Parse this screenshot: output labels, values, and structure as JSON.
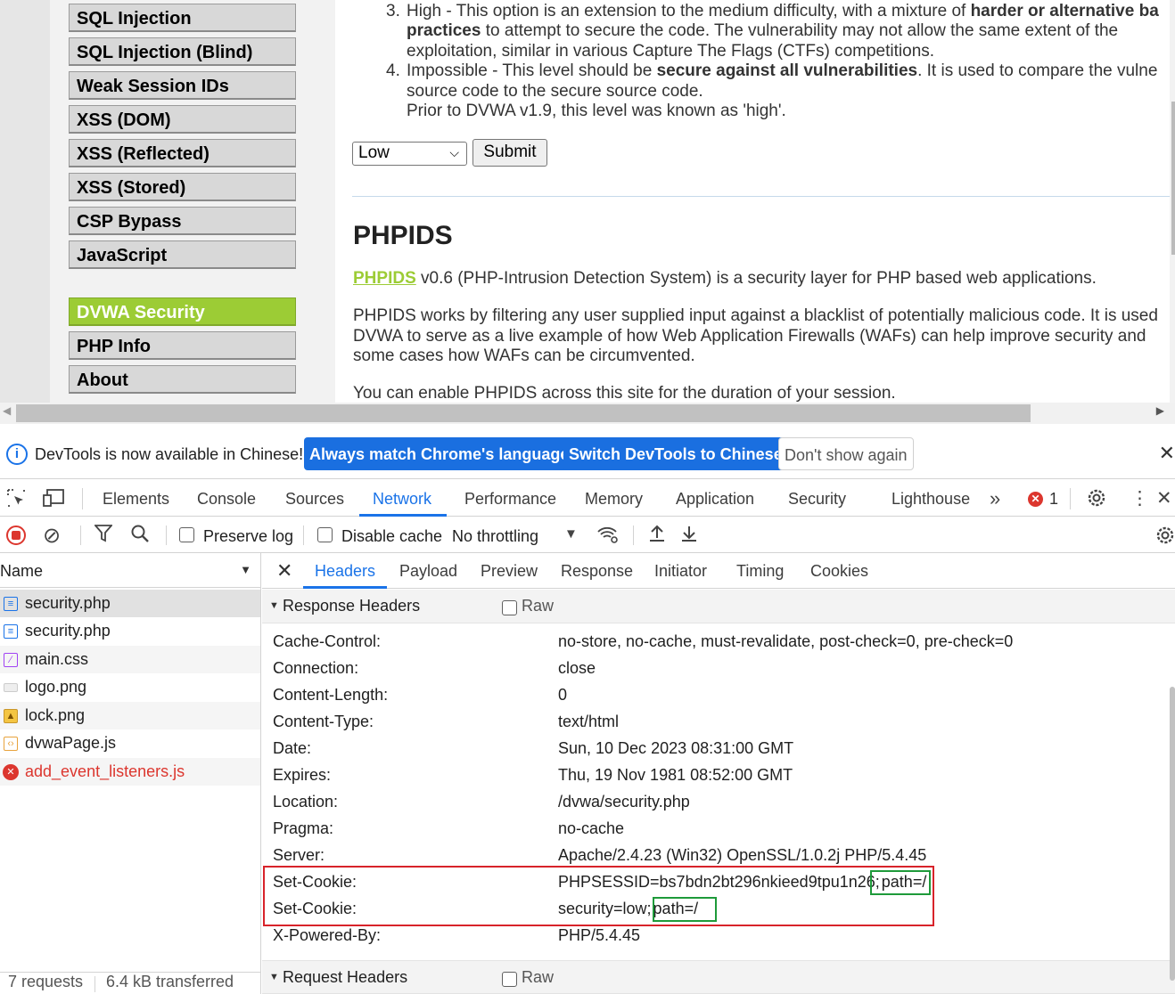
{
  "page": {
    "menu": [
      {
        "label": "SQL Injection",
        "active": false
      },
      {
        "label": "SQL Injection (Blind)",
        "active": false
      },
      {
        "label": "Weak Session IDs",
        "active": false
      },
      {
        "label": "XSS (DOM)",
        "active": false
      },
      {
        "label": "XSS (Reflected)",
        "active": false
      },
      {
        "label": "XSS (Stored)",
        "active": false
      },
      {
        "label": "CSP Bypass",
        "active": false
      },
      {
        "label": "JavaScript",
        "active": false
      },
      {
        "label": "DVWA Security",
        "active": true
      },
      {
        "label": "PHP Info",
        "active": false
      },
      {
        "label": "About",
        "active": false
      }
    ],
    "levels": {
      "high_num": "3.",
      "high_l1_a": "High - This option is an extension to the medium difficulty, with a mixture of ",
      "high_l1_b": "harder or alternative ba",
      "high_l2_a": "practices",
      "high_l2_b": " to attempt to secure the code. The vulnerability may not allow the same extent of the",
      "high_l3": "exploitation, similar in various Capture The Flags (CTFs) competitions.",
      "imp_num": "4.",
      "imp_l1_a": "Impossible - This level should be ",
      "imp_l1_b": "secure against all vulnerabilities",
      "imp_l1_c": ". It is used to compare the vulne",
      "imp_l2": "source code to the secure source code.",
      "imp_l3": "Prior to DVWA v1.9, this level was known as 'high'."
    },
    "security_select_value": "Low",
    "submit_label": "Submit",
    "phpids_heading": "PHPIDS",
    "phpids_link": "PHPIDS",
    "phpids_p1": " v0.6 (PHP-Intrusion Detection System) is a security layer for PHP based web applications.",
    "phpids_p2_l1": "PHPIDS works by filtering any user supplied input against a blacklist of potentially malicious code. It is used",
    "phpids_p2_l2": "DVWA to serve as a live example of how Web Application Firewalls (WAFs) can help improve security and",
    "phpids_p2_l3": "some cases how WAFs can be circumvented.",
    "phpids_p3": "You can enable PHPIDS across this site for the duration of your session."
  },
  "devtools": {
    "infobar": {
      "text": "DevTools is now available in Chinese!",
      "btn_match": "Always match Chrome's language",
      "btn_switch": "Switch DevTools to Chinese",
      "btn_dont_show": "Don't show again"
    },
    "tabs": [
      "Elements",
      "Console",
      "Sources",
      "Network",
      "Performance",
      "Memory",
      "Application",
      "Security",
      "Lighthouse"
    ],
    "active_tab": "Network",
    "error_count": "1",
    "toolbar": {
      "preserve_log": "Preserve log",
      "disable_cache": "Disable cache",
      "throttling": "No throttling"
    },
    "request_list": {
      "header": "Name",
      "items": [
        {
          "name": "security.php",
          "type": "document",
          "error": false
        },
        {
          "name": "security.php",
          "type": "document",
          "error": false
        },
        {
          "name": "main.css",
          "type": "stylesheet",
          "error": false
        },
        {
          "name": "logo.png",
          "type": "image",
          "error": false
        },
        {
          "name": "lock.png",
          "type": "image",
          "error": false
        },
        {
          "name": "dvwaPage.js",
          "type": "script",
          "error": false
        },
        {
          "name": "add_event_listeners.js",
          "type": "script",
          "error": true
        }
      ],
      "status_requests": "7 requests",
      "status_transferred": "6.4 kB transferred"
    },
    "detail_tabs": [
      "Headers",
      "Payload",
      "Preview",
      "Response",
      "Initiator",
      "Timing",
      "Cookies"
    ],
    "active_detail_tab": "Headers",
    "response_headers_title": "Response Headers",
    "request_headers_title": "Request Headers",
    "raw_label": "Raw",
    "response_headers": [
      {
        "name": "Cache-Control:",
        "value": "no-store, no-cache, must-revalidate, post-check=0, pre-check=0"
      },
      {
        "name": "Connection:",
        "value": "close"
      },
      {
        "name": "Content-Length:",
        "value": "0"
      },
      {
        "name": "Content-Type:",
        "value": "text/html"
      },
      {
        "name": "Date:",
        "value": "Sun, 10 Dec 2023 08:31:00 GMT"
      },
      {
        "name": "Expires:",
        "value": "Thu, 19 Nov 1981 08:52:00 GMT"
      },
      {
        "name": "Location:",
        "value": "/dvwa/security.php"
      },
      {
        "name": "Pragma:",
        "value": "no-cache"
      },
      {
        "name": "Server:",
        "value": "Apache/2.4.23 (Win32) OpenSSL/1.0.2j PHP/5.4.45"
      },
      {
        "name": "Set-Cookie:",
        "value": "PHPSESSID=bs7bdn2bt296nkieed9tpu1n26;",
        "suffix": "path=/"
      },
      {
        "name": "Set-Cookie:",
        "value": "security=low;",
        "suffix": "path=/"
      },
      {
        "name": "X-Powered-By:",
        "value": "PHP/5.4.45"
      }
    ],
    "highlight_colors": {
      "red_box": "#d8232a",
      "green_box": "#1e9a3a",
      "accent": "#1a73e8",
      "dvwa_green": "#9ccc35"
    }
  }
}
